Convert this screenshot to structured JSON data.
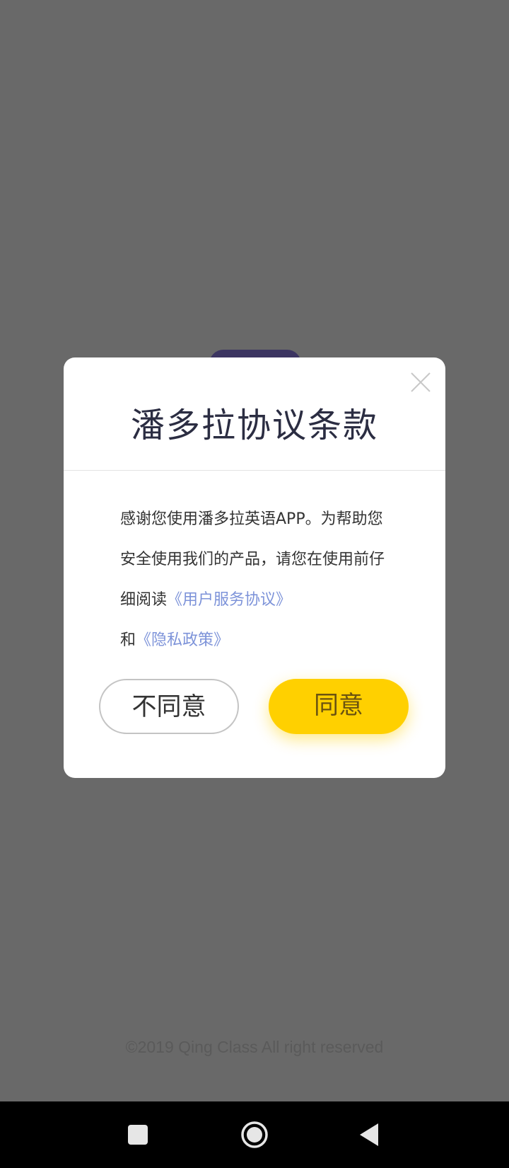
{
  "dialog": {
    "title": "潘多拉协议条款",
    "body": {
      "text_1": "感谢您使用潘多拉英语APP。为帮助您安全使用我们的产品，请您在使用前仔细阅读",
      "user_agreement_link": "《用户服务协议》",
      "text_2": "和",
      "privacy_policy_link": "《隐私政策》"
    },
    "disagree_label": "不同意",
    "agree_label": "同意",
    "close_icon": "close-icon"
  },
  "footer": {
    "copyright": "©2019 Qing Class All right reserved"
  },
  "navbar": {
    "recents_icon": "square-icon",
    "home_icon": "circle-icon",
    "back_icon": "triangle-back-icon"
  },
  "colors": {
    "backdrop": "#696969",
    "accent_yellow": "#ffd000",
    "link_blue": "#7d93d9",
    "title_text": "#2b2d42"
  }
}
